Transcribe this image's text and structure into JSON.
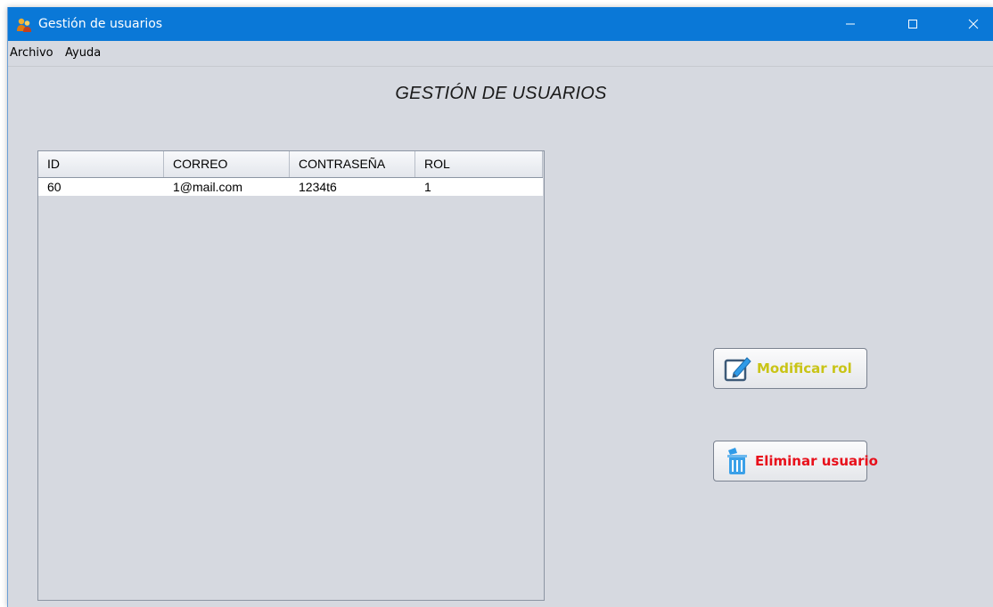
{
  "window": {
    "title": "Gestión de usuarios"
  },
  "menu": [
    "Archivo",
    "Ayuda"
  ],
  "page_title": "GESTIÓN DE USUARIOS",
  "table": {
    "columns": [
      "ID",
      "CORREO",
      "CONTRASEÑA",
      "ROL"
    ],
    "rows": [
      [
        "60",
        "1@mail.com",
        "1234t6",
        "1"
      ]
    ]
  },
  "buttons": {
    "modify": {
      "label": "Modificar rol",
      "color": "#c9c417",
      "icon": "edit-icon"
    },
    "delete": {
      "label": "Eliminar usuario",
      "color": "#e8101b",
      "icon": "trash-icon"
    }
  },
  "colors": {
    "titlebar": "#0a78d7",
    "background": "#d6d9e0"
  }
}
